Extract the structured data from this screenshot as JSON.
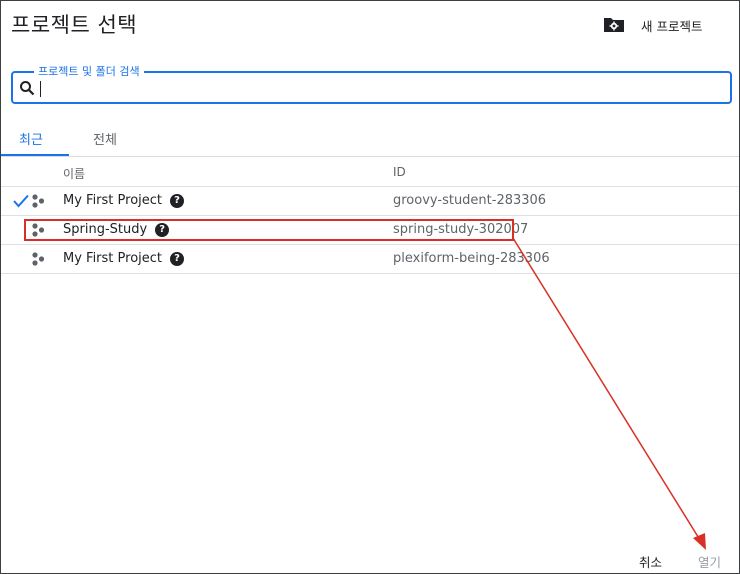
{
  "dialog": {
    "title": "프로젝트 선택",
    "new_project_label": "새 프로젝트"
  },
  "search": {
    "label": "프로젝트 및 폴더 검색",
    "value": ""
  },
  "tabs": [
    {
      "label": "최근",
      "active": true
    },
    {
      "label": "전체",
      "active": false
    }
  ],
  "table": {
    "columns": [
      "이름",
      "ID"
    ],
    "rows": [
      {
        "name": "My First Project",
        "id": "groovy-student-283306",
        "selected": true
      },
      {
        "name": "Spring-Study",
        "id": "spring-study-302007",
        "selected": false
      },
      {
        "name": "My First Project",
        "id": "plexiform-being-283306",
        "selected": false
      }
    ]
  },
  "footer": {
    "cancel_label": "취소",
    "open_label": "열기"
  },
  "colors": {
    "accent": "#1a73e8",
    "annotation_red": "#d93025",
    "disabled_text": "#9aa0a6"
  },
  "icons": [
    "new-folder-icon",
    "search-icon",
    "check-icon",
    "project-icon",
    "help-icon"
  ]
}
